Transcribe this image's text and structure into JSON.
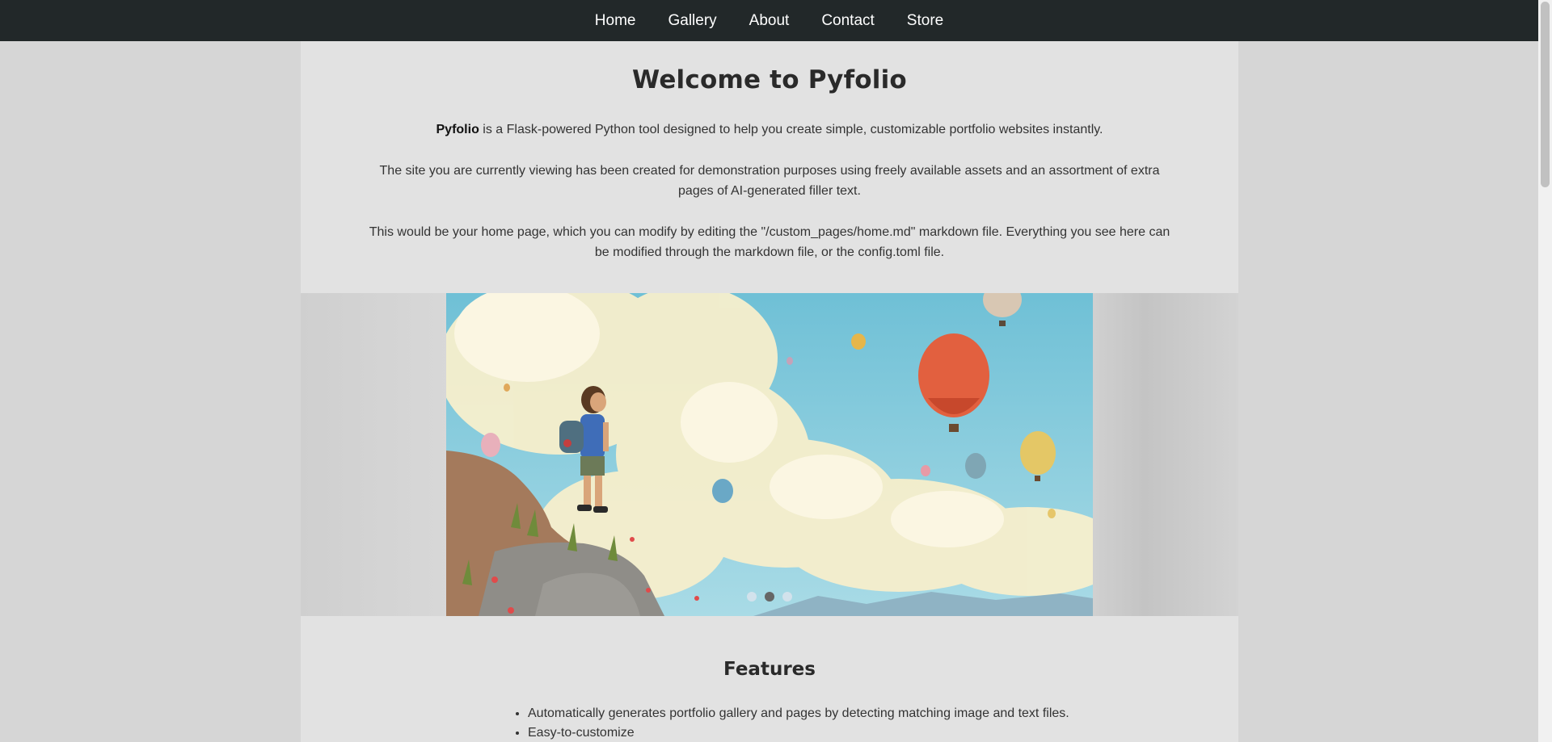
{
  "nav": {
    "items": [
      "Home",
      "Gallery",
      "About",
      "Contact",
      "Store"
    ]
  },
  "intro": {
    "title": "Welcome to Pyfolio",
    "p1_bold": "Pyfolio",
    "p1_rest": " is a Flask-powered Python tool designed to help you create simple, customizable portfolio websites instantly.",
    "p2": "The site you are currently viewing has been created for demonstration purposes using freely available assets and an assortment of extra pages of AI-generated filler text.",
    "p3": "This would be your home page, which you can modify by editing the \"/custom_pages/home.md\" markdown file. Everything you see here can be modified through the markdown file, or the config.toml file."
  },
  "slideshow": {
    "dot_count": 3,
    "active_dot": 2
  },
  "features": {
    "title": "Features",
    "items": [
      "Automatically generates portfolio gallery and pages by detecting matching image and text files.",
      "Easy-to-customize"
    ]
  },
  "colors": {
    "nav_bg": "#222829",
    "panel_bg": "#e2e2e2",
    "page_bg": "#d6d6d6"
  }
}
